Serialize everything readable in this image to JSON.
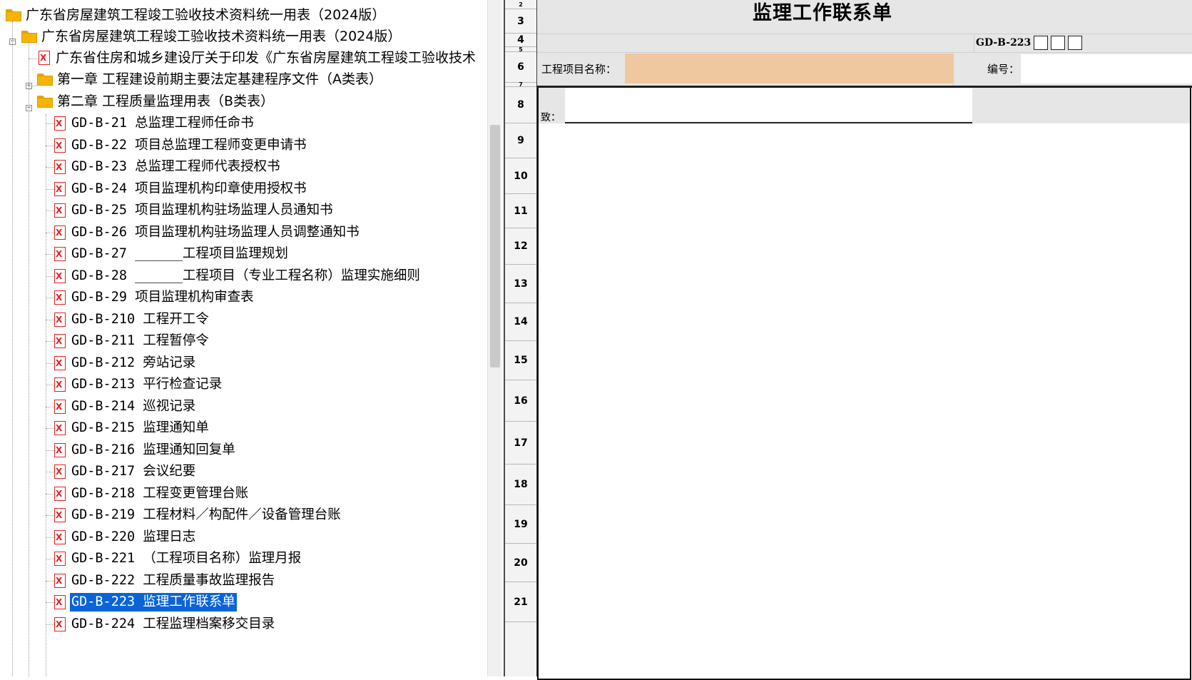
{
  "tree": {
    "root_label": "广东省房屋建筑工程竣工验收技术资料统一用表（2024版）",
    "sub_root_label": "广东省房屋建筑工程竣工验收技术资料统一用表（2024版）",
    "notice_label": "广东省住房和城乡建设厅关于印发《广东省房屋建筑工程竣工验收技术",
    "chapter1_label": "第一章  工程建设前期主要法定基建程序文件（A类表）",
    "chapter2_label": "第二章  工程质量监理用表（B类表）",
    "chapter2_items": [
      "GD-B-21 总监理工程师任命书",
      "GD-B-22 项目总监理工程师变更申请书",
      "GD-B-23 总监理工程师代表授权书",
      "GD-B-24 项目监理机构印章使用授权书",
      "GD-B-25 项目监理机构驻场监理人员通知书",
      "GD-B-26 项目监理机构驻场监理人员调整通知书",
      "GD-B-27 ______工程项目监理规划",
      "GD-B-28 ______工程项目（专业工程名称）监理实施细则",
      "GD-B-29 项目监理机构审查表",
      "GD-B-210 工程开工令",
      "GD-B-211 工程暂停令",
      "GD-B-212 旁站记录",
      "GD-B-213 平行检查记录",
      "GD-B-214 巡视记录",
      "GD-B-215 监理通知单",
      "GD-B-216 监理通知回复单",
      "GD-B-217 会议纪要",
      "GD-B-218 工程变更管理台账",
      "GD-B-219 工程材料／构配件／设备管理台账",
      "GD-B-220 监理日志",
      "GD-B-221 （工程项目名称）监理月报",
      "GD-B-222 工程质量事故监理报告",
      "GD-B-223 监理工作联系单",
      "GD-B-224 工程监理档案移交目录"
    ],
    "selected_index": 22,
    "doc_icon_glyph": "X",
    "expand_glyph": "+",
    "collapse_glyph": "−"
  },
  "sheet": {
    "form_title": "监理工作联系单",
    "form_code": "GD-B-223",
    "project_name_label": "工程项目名称：",
    "project_name_value": "",
    "number_label": "编号：",
    "number_value": "",
    "to_label": "致：",
    "to_value": "",
    "row_numbers": [
      "2",
      "3",
      "4",
      "5",
      "6",
      "7",
      "8",
      "9",
      "10",
      "11",
      "12",
      "13",
      "14",
      "15",
      "16",
      "17",
      "18",
      "19",
      "20",
      "21"
    ],
    "input_highlight_color": "#f0c8a0"
  }
}
